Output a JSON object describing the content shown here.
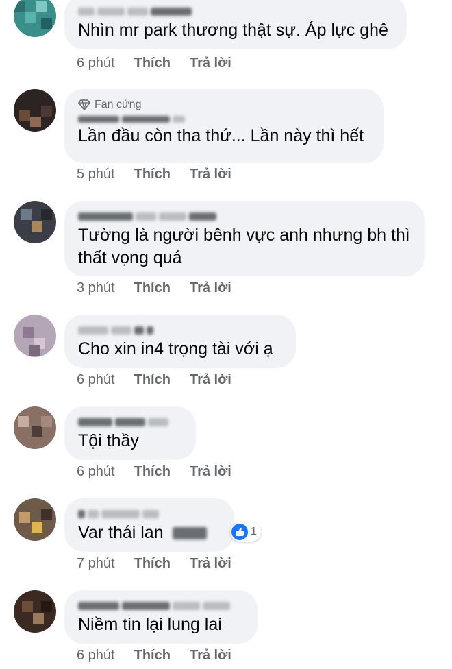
{
  "comments": [
    {
      "text": "Nhìn mr park thương thật sự. Áp lực ghê",
      "time": "6 phút",
      "like": "Thích",
      "reply": "Trả lời"
    },
    {
      "badge": "Fan cứng",
      "text": "Lần đầu còn tha thứ... Lần này thì hết",
      "time": "5 phút",
      "like": "Thích",
      "reply": "Trả lời"
    },
    {
      "text_line1": "Tường là người bênh vực anh nhưng bh thì",
      "text_line2": "thất vọng quá",
      "time": "3 phút",
      "like": "Thích",
      "reply": "Trả lời"
    },
    {
      "text": "Cho xin in4  trọng tài với ạ",
      "time": "6 phút",
      "like": "Thích",
      "reply": "Trả lời"
    },
    {
      "text": "Tội thầy",
      "time": "6 phút",
      "like": "Thích",
      "reply": "Trả lời"
    },
    {
      "text": "Var thái lan",
      "time": "7 phút",
      "like": "Thích",
      "reply": "Trả lời",
      "reaction_count": "1"
    },
    {
      "text": "Niềm tin lại lung lai",
      "time": "6 phút",
      "like": "Thích",
      "reply": "Trả lời"
    }
  ],
  "colors": {
    "bubble": "#f0f2f5",
    "meta_text": "#65676b",
    "like_blue": "#1877f2"
  },
  "icons": {
    "badge": "diamond-icon",
    "reaction": "thumbs-up-icon"
  }
}
